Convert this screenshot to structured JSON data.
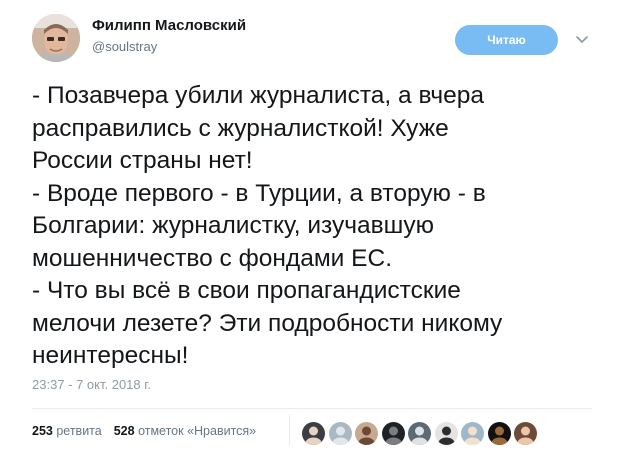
{
  "profile": {
    "name": "Филипп Масловский",
    "handle": "@soulstray",
    "follow_label": "Читаю"
  },
  "tweet": {
    "lines": [
      "- Позавчера убили журналиста, а вчера",
      "расправились с журналисткой! Хуже",
      "России страны нет!",
      "- Вроде первого - в Турции, а вторую - в",
      "Болгарии: журналистку, изучавшую",
      "мошенничество с фондами ЕС.",
      "- Что вы всё в свои пропагандистские",
      "мелочи лезете? Эти подробности никому",
      "неинтересны!"
    ],
    "timestamp": "23:37 - 7 окт. 2018 г."
  },
  "stats": {
    "retweets_count": "253",
    "retweets_label": "ретвита",
    "likes_count": "528",
    "likes_label": "отметок «Нравится»"
  },
  "likers": [
    {
      "name": "liker-1",
      "bg": "#3b3f44",
      "fg": "#e7d3c2"
    },
    {
      "name": "liker-2",
      "bg": "#aab8c2",
      "fg": "#e1e8ed"
    },
    {
      "name": "liker-3",
      "bg": "#c8a98f",
      "fg": "#6a4a35"
    },
    {
      "name": "liker-4",
      "bg": "#1f2326",
      "fg": "#7a7e82"
    },
    {
      "name": "liker-5",
      "bg": "#5d6a73",
      "fg": "#dce2e6"
    },
    {
      "name": "liker-6",
      "bg": "#e4e4e4",
      "fg": "#2d2d2d"
    },
    {
      "name": "liker-7",
      "bg": "#9fb7c9",
      "fg": "#f3e1d0"
    },
    {
      "name": "liker-8",
      "bg": "#111111",
      "fg": "#9a6a3a"
    },
    {
      "name": "liker-9",
      "bg": "#6e4a3a",
      "fg": "#e9c7a8"
    }
  ],
  "colors": {
    "follow_button": "#79bcf3",
    "muted_text": "#657786",
    "divider": "#e6ecf0"
  }
}
